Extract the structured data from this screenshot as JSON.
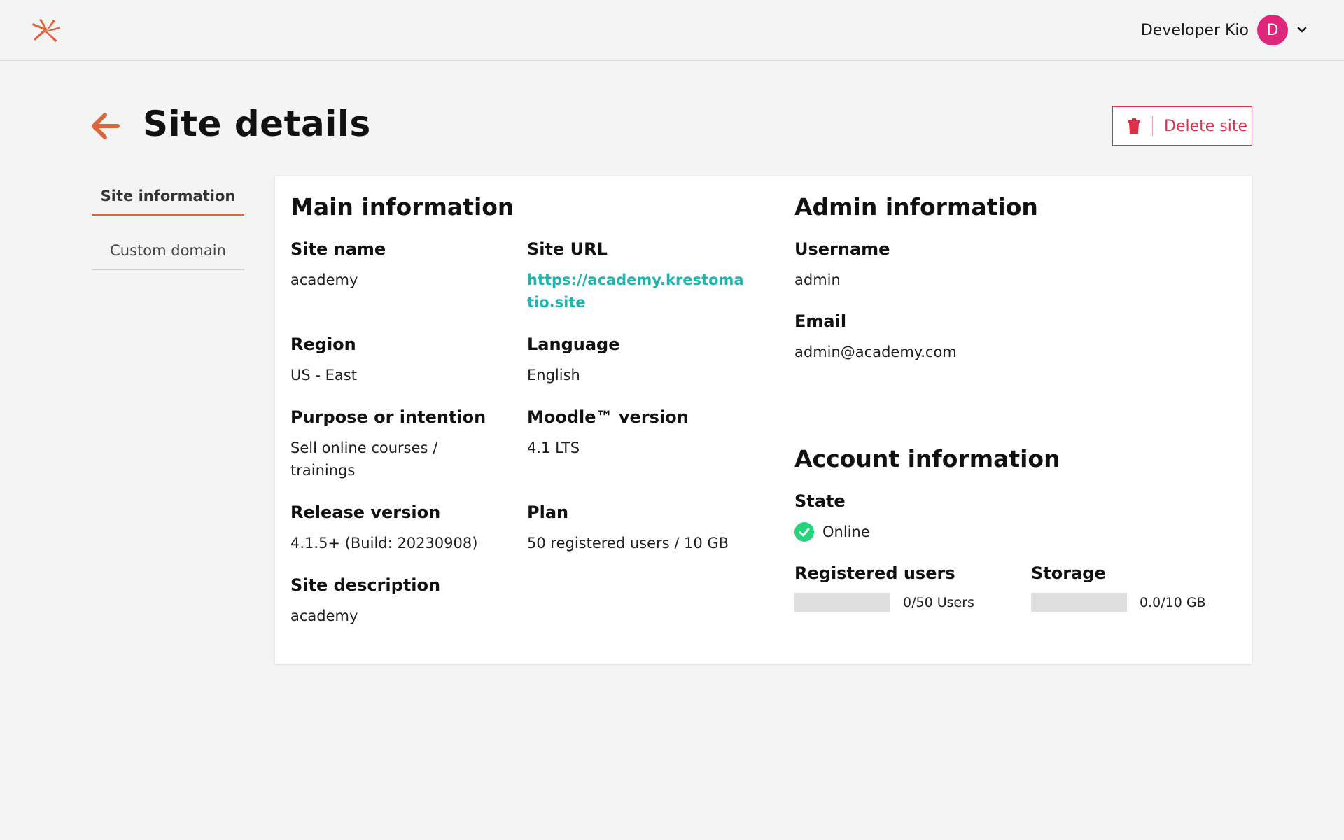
{
  "header": {
    "user_name": "Developer Kio",
    "avatar_initial": "D",
    "page_title": "Site details",
    "delete_label": "Delete site"
  },
  "tabs": [
    {
      "label": "Site information",
      "active": true
    },
    {
      "label": "Custom domain",
      "active": false
    }
  ],
  "main_info": {
    "title": "Main information",
    "site_name": {
      "label": "Site name",
      "value": "academy"
    },
    "site_url": {
      "label": "Site URL",
      "value": "https://academy.krestomatio.site"
    },
    "region": {
      "label": "Region",
      "value": "US - East"
    },
    "language": {
      "label": "Language",
      "value": "English"
    },
    "purpose": {
      "label": "Purpose or intention",
      "value": "Sell online courses / trainings"
    },
    "moodle_version": {
      "label": "Moodle™ version",
      "value": "4.1 LTS"
    },
    "release_version": {
      "label": "Release version",
      "value": "4.1.5+ (Build: 20230908)"
    },
    "plan": {
      "label": "Plan",
      "value": "50 registered users / 10 GB"
    },
    "description": {
      "label": "Site description",
      "value": "academy"
    }
  },
  "admin_info": {
    "title": "Admin information",
    "username": {
      "label": "Username",
      "value": "admin"
    },
    "email": {
      "label": "Email",
      "value": "admin@academy.com"
    }
  },
  "account_info": {
    "title": "Account information",
    "state": {
      "label": "State",
      "value": "Online"
    },
    "registered_users": {
      "label": "Registered users",
      "value": "0/50 Users",
      "fraction": 0
    },
    "storage": {
      "label": "Storage",
      "value": "0.0/10 GB",
      "fraction": 0
    }
  },
  "colors": {
    "accent": "#e0643a",
    "danger": "#d9324a",
    "link": "#1fb5b0",
    "avatar": "#e0267a",
    "online": "#22d47a"
  },
  "icons": [
    "logo-icon",
    "chevron-down-icon",
    "arrow-left-icon",
    "trash-icon",
    "check-circle-icon"
  ]
}
